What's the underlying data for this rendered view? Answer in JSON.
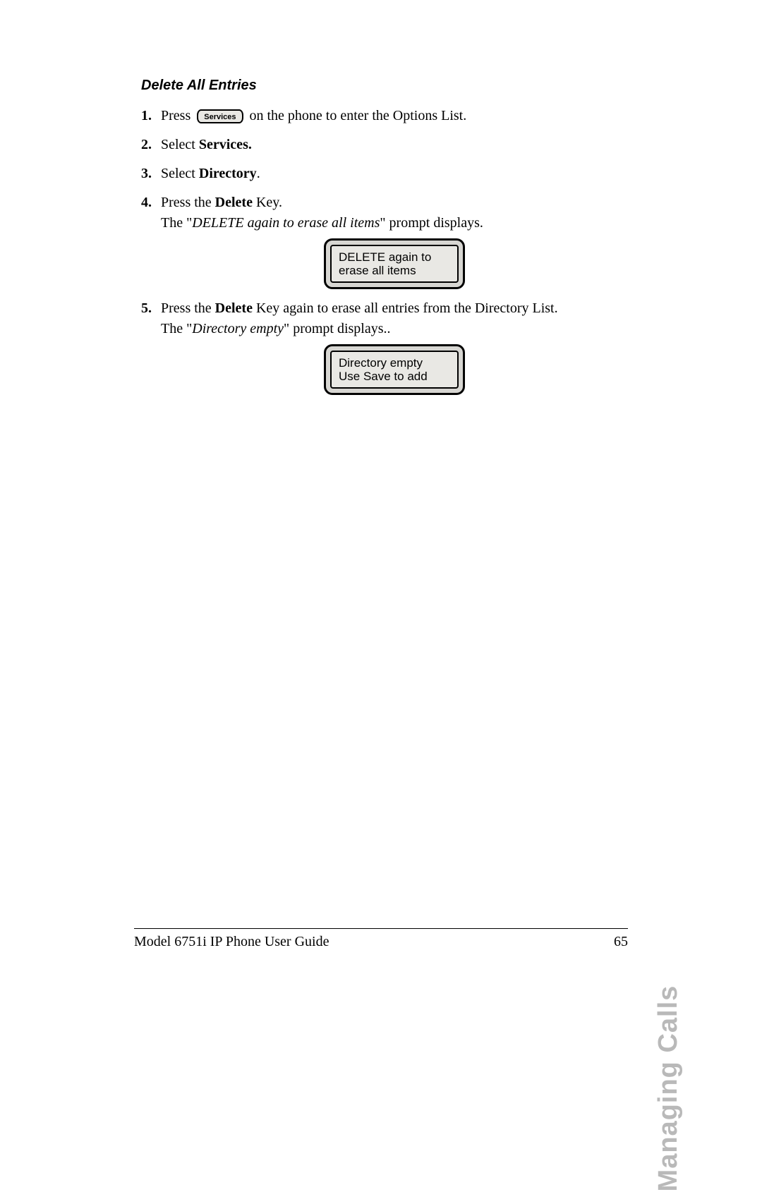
{
  "heading": "Delete All Entries",
  "servicesKeyLabel": "Services",
  "steps": {
    "s1": {
      "pre": "Press ",
      "post": " on the phone to enter the Options List."
    },
    "s2": {
      "pre": "Select ",
      "bold": "Services."
    },
    "s3": {
      "pre": "Select ",
      "bold": "Directory",
      "post": "."
    },
    "s4": {
      "pre": "Press the ",
      "bold": "Delete",
      "post": " Key.",
      "subPre": "The \"",
      "subItalic": "DELETE again to erase all items",
      "subPost": "\" prompt displays."
    },
    "s5": {
      "pre": "Press the ",
      "bold": "Delete",
      "post": " Key again to erase all entries from the Directory List.",
      "subPre": "The \"",
      "subItalic": "Directory empty",
      "subPost": "\" prompt displays.."
    }
  },
  "lcd1": {
    "line1": "DELETE again to",
    "line2": "erase all items"
  },
  "lcd2": {
    "line1": "Directory empty",
    "line2": "Use Save to add"
  },
  "sectionTab": "Managing Calls",
  "footer": {
    "title": "Model 6751i IP Phone User Guide",
    "page": "65"
  }
}
